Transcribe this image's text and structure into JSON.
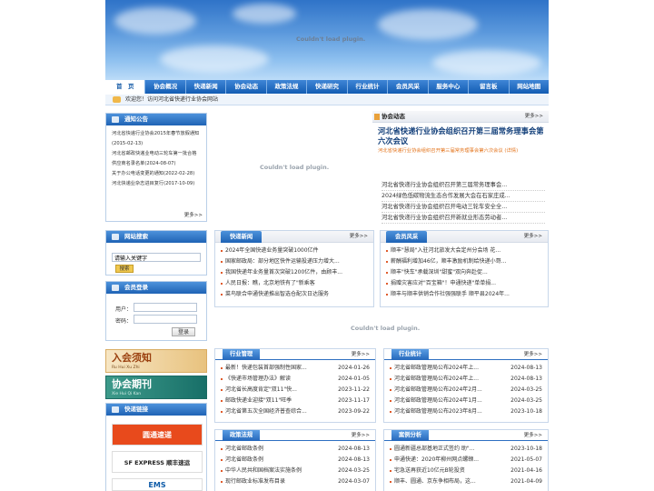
{
  "banner": {
    "plugin_text": "Couldn't load plugin."
  },
  "nav": [
    "首　页",
    "协会概况",
    "快递新闻",
    "协会动态",
    "政策法规",
    "快递研究",
    "行业统计",
    "会员风采",
    "服务中心",
    "留言板",
    "网站地图"
  ],
  "welcome": "欢迎您！访问河北省快递行业协会网站",
  "notice": {
    "title": "通知公告",
    "items": [
      "河北省快递行业协会2015年春节放假通知(2015-02-13)",
      "河北省邮政快递业电动三轮车第一批合格供应商名录名单(2024-08-07)",
      "关于办公电话变更的通知(2022-02-28)",
      "河北快递业杂志进目复行(2017-10-09)"
    ],
    "more": "更多>>"
  },
  "center_plugin": "Couldn't load plugin.",
  "dynamic": {
    "title": "协会动态",
    "more": "更多>>",
    "headline": "河北省快递行业协会组织召开第三届常务理事会第六次会议",
    "sub": "河北省快递行业协会组织召开第三届常务理事会第六次会议 (详情)",
    "items": [
      "河北省快递行业协会组织召开第三届常务理事会...",
      "2024绿色低碳物流生态合作发展大会在石家庄成...",
      "河北省快递行业协会组织召开电动三轮车安全全...",
      "河北省快递行业协会组织召开新就业形态劳动者..."
    ]
  },
  "search": {
    "title": "网站搜索",
    "placeholder": "请输入关键字",
    "button": "搜索"
  },
  "login": {
    "title": "会员登录",
    "user_label": "用户：",
    "pass_label": "密码：",
    "button": "登录"
  },
  "news": {
    "title": "快递新闻",
    "more": "更多>>",
    "items": [
      "2024年全国快递业务量突破1000亿件",
      "国家邮政局：部分地区快件运输投递压力增大...",
      "我国快递年业务量首次突破1200亿件，由顾丰...",
      "人民日报：瞧，北京地铁有了\"新乘客",
      "菜鸟联合申通快递推出智选仓配次日达服务"
    ]
  },
  "members": {
    "title": "会员风采",
    "more": "更多>>",
    "items": [
      "顺丰\"慧局\"入驻河北旅发大会定州分会场 花...",
      "薪酬福利增加46亿，顺丰激励机制给快递小哥...",
      "顺丰\"快车\"承载深圳\"甜蜜\"双向奔赴促...",
      "捐赠灾害应对\"百宝箱\"！申通快递\"单单捐...",
      "顺丰与顺丰供销合作社强强联手 顺平县2024年..."
    ]
  },
  "mid_plugin": "Couldn't load plugin.",
  "ad1": {
    "title": "入会须知",
    "sub": "Ru Hui Xu Zhi"
  },
  "ad2": {
    "title": "协会期刊",
    "sub": "Xie Hui Qi Kan"
  },
  "links": {
    "title": "快递链接",
    "items": [
      "圆通速递",
      "SF EXPRESS 顺丰速运",
      "EMS"
    ]
  },
  "industry": {
    "title": "行业管理",
    "more": "更多>>",
    "items": [
      [
        "最新！快递包装首部强制性国家...",
        "2024-01-26"
      ],
      [
        "《快递市场管理办法》解读",
        "2024-01-05"
      ],
      [
        "河北省长高度肯定\"双11\"快...",
        "2023-11-22"
      ],
      [
        "邮政快递业迎接\"双11\"旺季",
        "2023-11-17"
      ],
      [
        "河北省第五次全国经济普查综合...",
        "2023-09-22"
      ]
    ]
  },
  "stats": {
    "title": "行业统计",
    "more": "更多>>",
    "items": [
      [
        "河北省邮政管理局公布2024年上...",
        "2024-08-13"
      ],
      [
        "河北省邮政管理局公布2024年上...",
        "2024-08-13"
      ],
      [
        "河北省邮政管理局公布2024年2月...",
        "2024-03-25"
      ],
      [
        "河北省邮政管理局公布2024年1月...",
        "2024-03-25"
      ],
      [
        "河北省邮政管理局公布2023年8月...",
        "2023-10-18"
      ]
    ]
  },
  "policy": {
    "title": "政策法规",
    "more": "更多>>",
    "items": [
      [
        "河北省邮政条例",
        "2024-08-13"
      ],
      [
        "河北省邮政条例",
        "2024-08-13"
      ],
      [
        "中华人民共和国档案法实施条例",
        "2024-03-25"
      ],
      [
        "现行邮政业标准发布目录",
        "2024-03-07"
      ]
    ]
  },
  "cases": {
    "title": "案例分析",
    "more": "更多>>",
    "items": [
      [
        "圆通新疆总部基地正式签约 助\"...",
        "2023-10-18"
      ],
      [
        "申通快递：2020年柳州网点螺蛳...",
        "2021-05-07"
      ],
      [
        "宅急送再获近10亿元B轮投资",
        "2021-04-16"
      ],
      [
        "顺丰、圆通、京东争相布局，这...",
        "2021-04-09"
      ]
    ]
  }
}
